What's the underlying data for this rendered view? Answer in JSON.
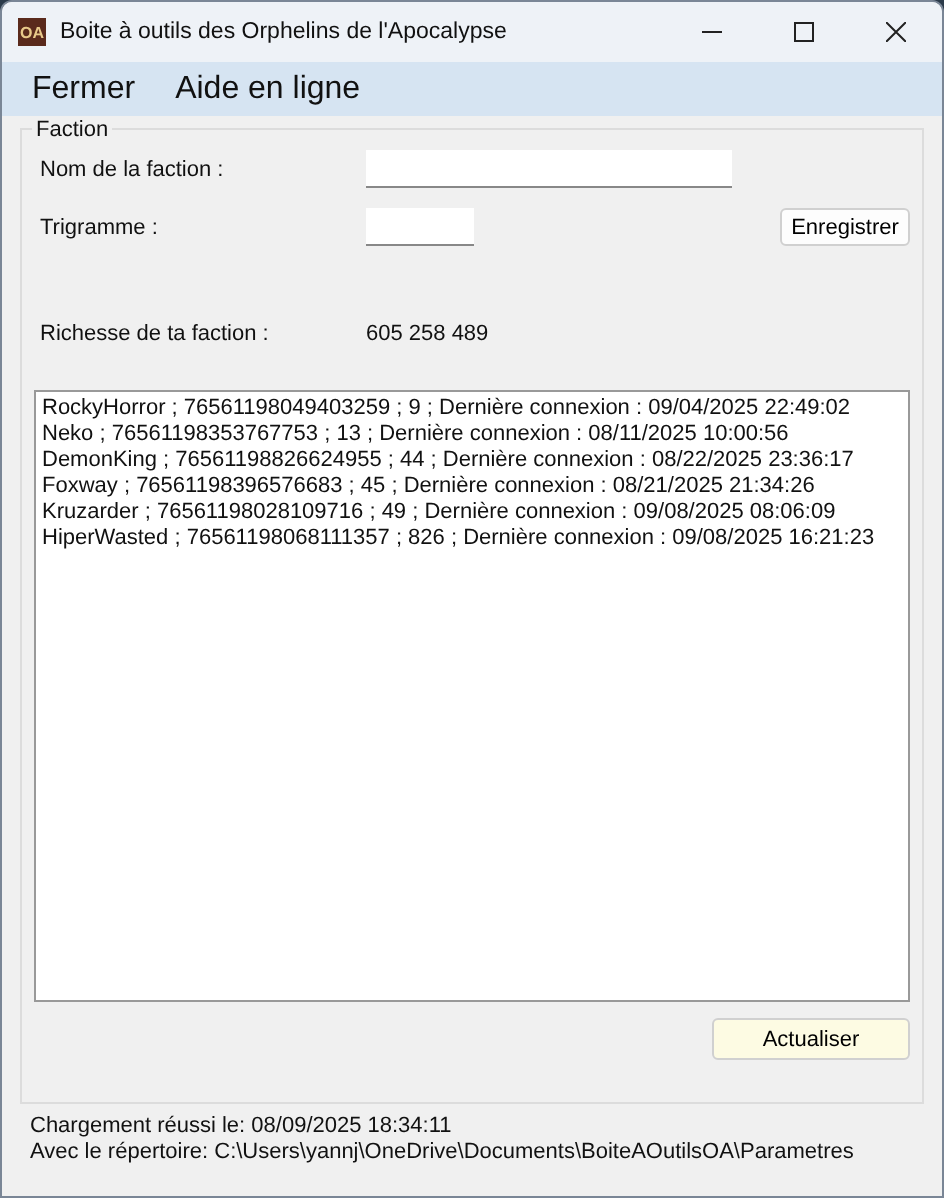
{
  "window": {
    "icon_text": "OA",
    "title": "Boite à outils des Orphelins de l'Apocalypse"
  },
  "menu": [
    "Fermer",
    "Aide en ligne"
  ],
  "faction": {
    "legend": "Faction",
    "name_label": "Nom de la faction :",
    "trigram_label": "Trigramme :",
    "save_button": "Enregistrer",
    "wealth_label": "Richesse de ta faction :",
    "wealth_value": "605 258 489",
    "members": [
      "RockyHorror ; 76561198049403259 ; 9 ; Dernière connexion : 09/04/2025 22:49:02",
      "Neko ; 76561198353767753 ; 13 ; Dernière connexion : 08/11/2025 10:00:56",
      "DemonKing ; 76561198826624955 ; 44 ; Dernière connexion : 08/22/2025 23:36:17",
      "Foxway ; 76561198396576683 ; 45 ; Dernière connexion : 08/21/2025 21:34:26",
      "Kruzarder ; 76561198028109716 ; 49 ; Dernière connexion : 09/08/2025 08:06:09",
      "HiperWasted ; 76561198068111357 ; 826 ; Dernière connexion : 09/08/2025 16:21:23"
    ],
    "refresh_button": "Actualiser"
  },
  "status": [
    "Chargement réussi le: 08/09/2025 18:34:11",
    "Avec le répertoire: C:\\Users\\yannj\\OneDrive\\Documents\\BoiteAOutilsOA\\Parametres"
  ]
}
